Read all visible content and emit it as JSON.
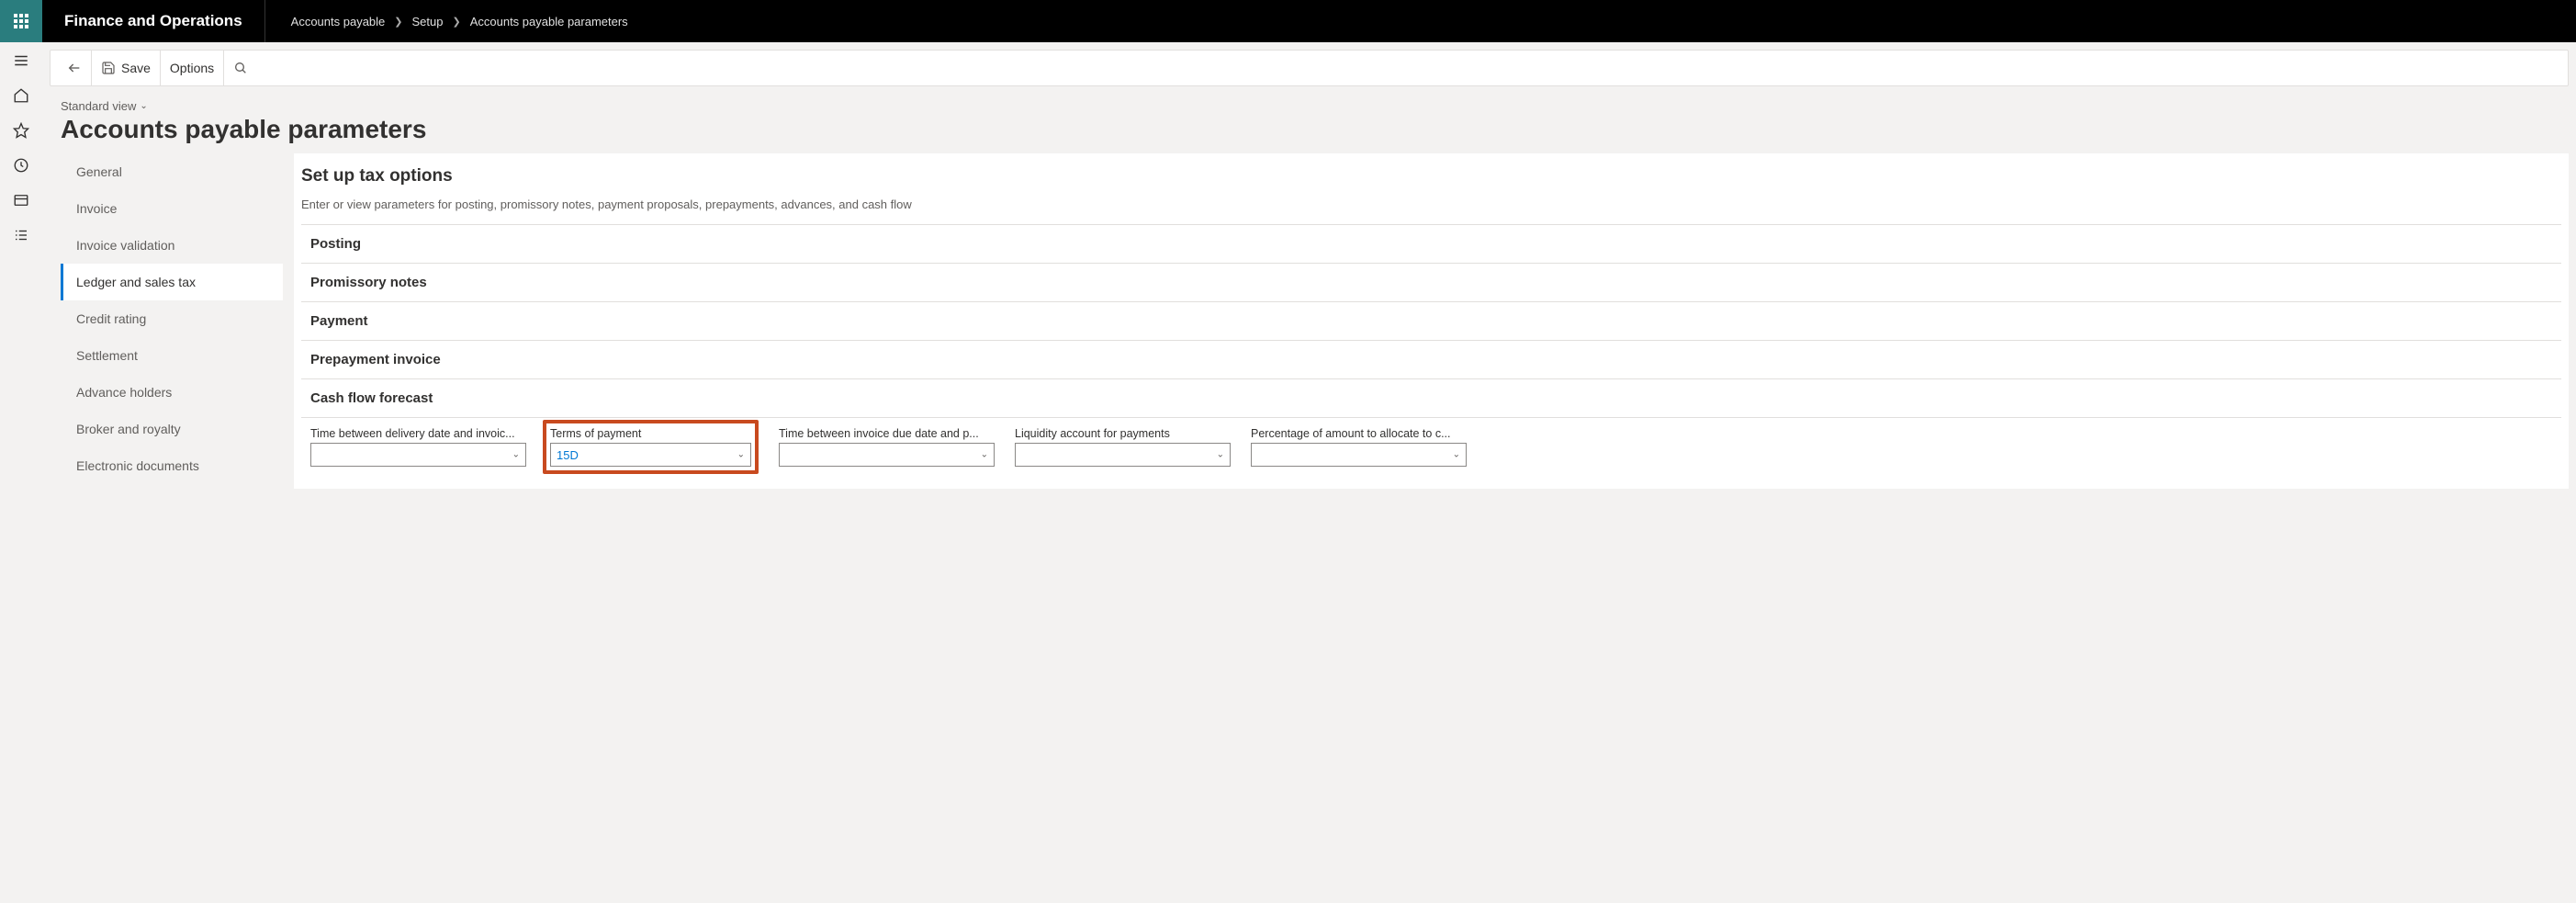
{
  "header": {
    "app_title": "Finance and Operations",
    "breadcrumb": [
      "Accounts payable",
      "Setup",
      "Accounts payable parameters"
    ]
  },
  "toolbar": {
    "save_label": "Save",
    "options_label": "Options"
  },
  "page": {
    "view_label": "Standard view",
    "title": "Accounts payable parameters"
  },
  "nav": {
    "items": [
      {
        "label": "General",
        "active": false
      },
      {
        "label": "Invoice",
        "active": false
      },
      {
        "label": "Invoice validation",
        "active": false
      },
      {
        "label": "Ledger and sales tax",
        "active": true
      },
      {
        "label": "Credit rating",
        "active": false
      },
      {
        "label": "Settlement",
        "active": false
      },
      {
        "label": "Advance holders",
        "active": false
      },
      {
        "label": "Broker and royalty",
        "active": false
      },
      {
        "label": "Electronic documents",
        "active": false
      }
    ]
  },
  "main": {
    "section_title": "Set up tax options",
    "section_description": "Enter or view parameters for posting, promissory notes, payment proposals, prepayments, advances, and cash flow",
    "groups": [
      {
        "label": "Posting"
      },
      {
        "label": "Promissory notes"
      },
      {
        "label": "Payment"
      },
      {
        "label": "Prepayment invoice"
      },
      {
        "label": "Cash flow forecast"
      }
    ],
    "fields": [
      {
        "label": "Time between delivery date and invoic...",
        "value": "",
        "highlighted": false
      },
      {
        "label": "Terms of payment",
        "value": "15D",
        "highlighted": true
      },
      {
        "label": "Time between invoice due date and p...",
        "value": "",
        "highlighted": false
      },
      {
        "label": "Liquidity account for payments",
        "value": "",
        "highlighted": false
      },
      {
        "label": "Percentage of amount to allocate to c...",
        "value": "",
        "highlighted": false
      }
    ]
  }
}
